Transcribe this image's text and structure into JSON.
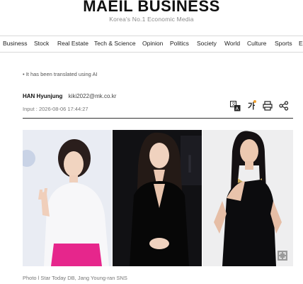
{
  "masthead": {
    "logo": "MAEIL BUSINESS",
    "tagline": "Korea's No.1 Economic Media"
  },
  "nav": {
    "items": [
      "Business",
      "Stock",
      "Real Estate",
      "Tech & Science",
      "Opinion",
      "Politics",
      "Society",
      "World",
      "Culture",
      "Sports",
      "E"
    ]
  },
  "article": {
    "notice": "• It has been translated using AI",
    "author": "HAN Hyunjung",
    "email": "kiki2022@mk.co.kr",
    "input_label": "Input : ",
    "input_date": "2026-08-06 17:44:27",
    "tools": [
      "translate-icon",
      "font-size-icon",
      "print-icon",
      "share-icon"
    ],
    "font_tool_label": "가",
    "photo_caption": "Photo l Star Today DB, Jang Young-ran SNS"
  },
  "colors": {
    "accent_dot": "#f0a030",
    "rule": "#333333",
    "nav_border": "#d9d9d9"
  }
}
